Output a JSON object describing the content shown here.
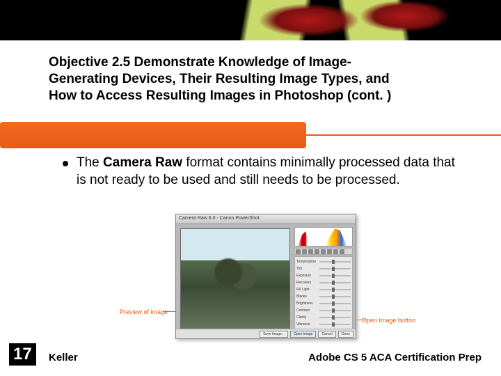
{
  "header": {
    "title_line1": "Objective 2.5 Demonstrate Knowledge of Image-",
    "title_line2": "Generating Devices, Their Resulting Image Types, and",
    "title_line3": "How to Access Resulting Images in Photoshop (cont. )"
  },
  "bullet": {
    "pre": "The ",
    "bold": "Camera Raw",
    "post": " format contains minimally processed data that is not ready to be used and still needs to be processed."
  },
  "figure": {
    "callout_left": "Preview of image",
    "callout_right": "Open Image button",
    "dialog_title": "Camera Raw 6.0 - Canon PowerShot",
    "sliders": [
      "Temperature",
      "Tint",
      "Exposure",
      "Recovery",
      "Fill Light",
      "Blacks",
      "Brightness",
      "Contrast",
      "Clarity",
      "Vibrance"
    ],
    "buttons": {
      "save": "Save Image...",
      "open": "Open Image",
      "cancel": "Cancel",
      "done": "Done"
    }
  },
  "footer": {
    "page": "17",
    "left": "Keller",
    "right": "Adobe CS 5 ACA Certification Prep"
  }
}
